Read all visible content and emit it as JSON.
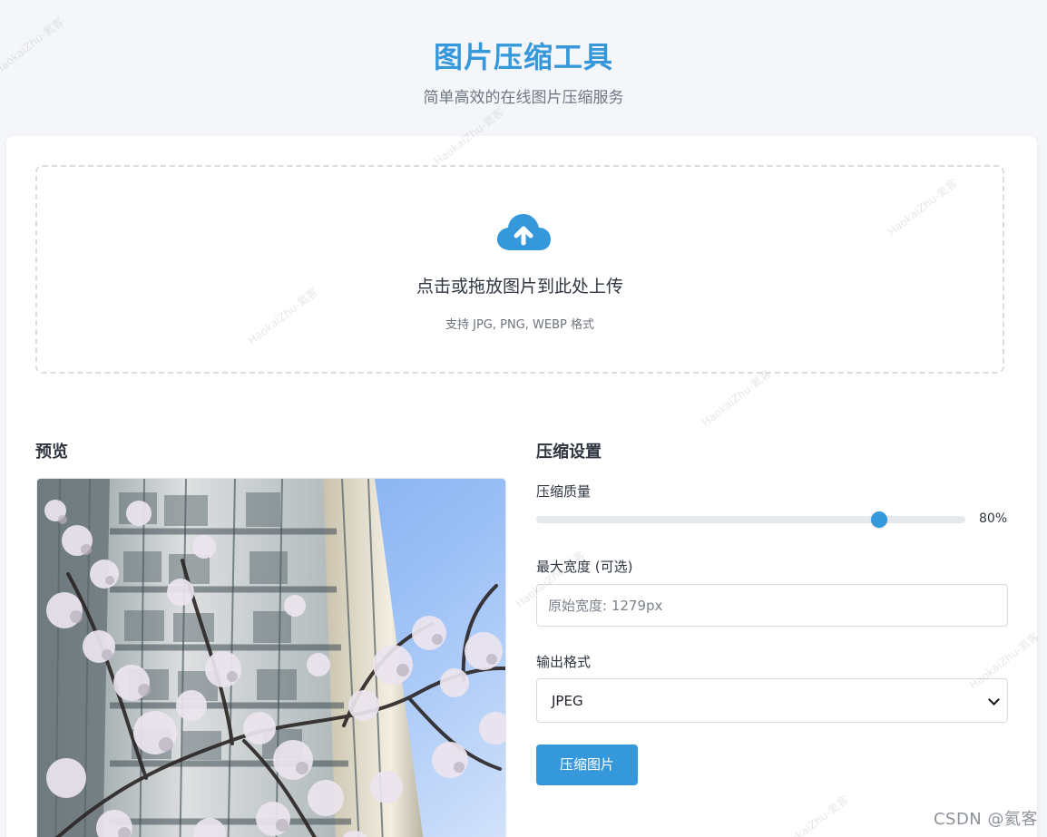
{
  "header": {
    "title": "图片压缩工具",
    "subtitle": "简单高效的在线图片压缩服务"
  },
  "upload": {
    "icon": "cloud-upload-icon",
    "text": "点击或拖放图片到此处上传",
    "hint": "支持 JPG, PNG, WEBP 格式"
  },
  "preview": {
    "title": "预览",
    "image_subject": "cherry blossoms in front of residential tower block"
  },
  "settings": {
    "title": "压缩设置",
    "quality_label": "压缩质量",
    "quality_value": "80%",
    "quality_fraction": 0.8,
    "max_width_label": "最大宽度 (可选)",
    "max_width_placeholder": "原始宽度: 1279px",
    "output_format_label": "输出格式",
    "output_format_value": "JPEG",
    "compress_button": "压缩图片"
  },
  "footer": {
    "credit": "CSDN @氦客"
  },
  "watermark": {
    "text": "HaokaiZhu-氦客"
  },
  "colors": {
    "accent": "#3498db",
    "background": "#f4f6fa",
    "card": "#ffffff",
    "muted_text": "#6f7782"
  }
}
